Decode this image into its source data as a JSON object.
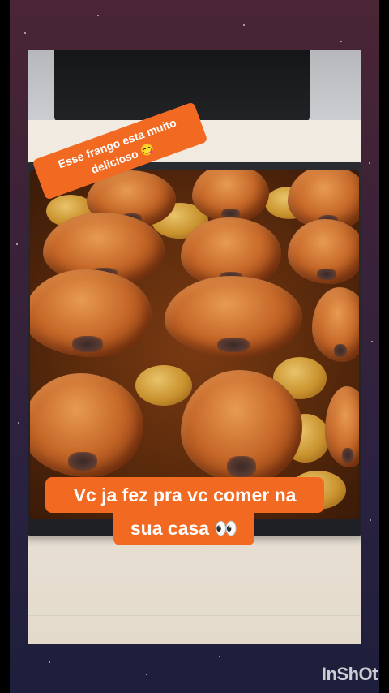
{
  "captions": {
    "top": "Esse frango esta muito delicioso 😋",
    "bottom_line1": "Vc ja fez pra vc comer na",
    "bottom_line2": "sua casa 👀"
  },
  "watermark": "InShOt",
  "colors": {
    "caption_bg": "#f26a22",
    "caption_text": "#ffffff",
    "background_top": "#4a2535",
    "background_bottom": "#1d1f3c"
  }
}
